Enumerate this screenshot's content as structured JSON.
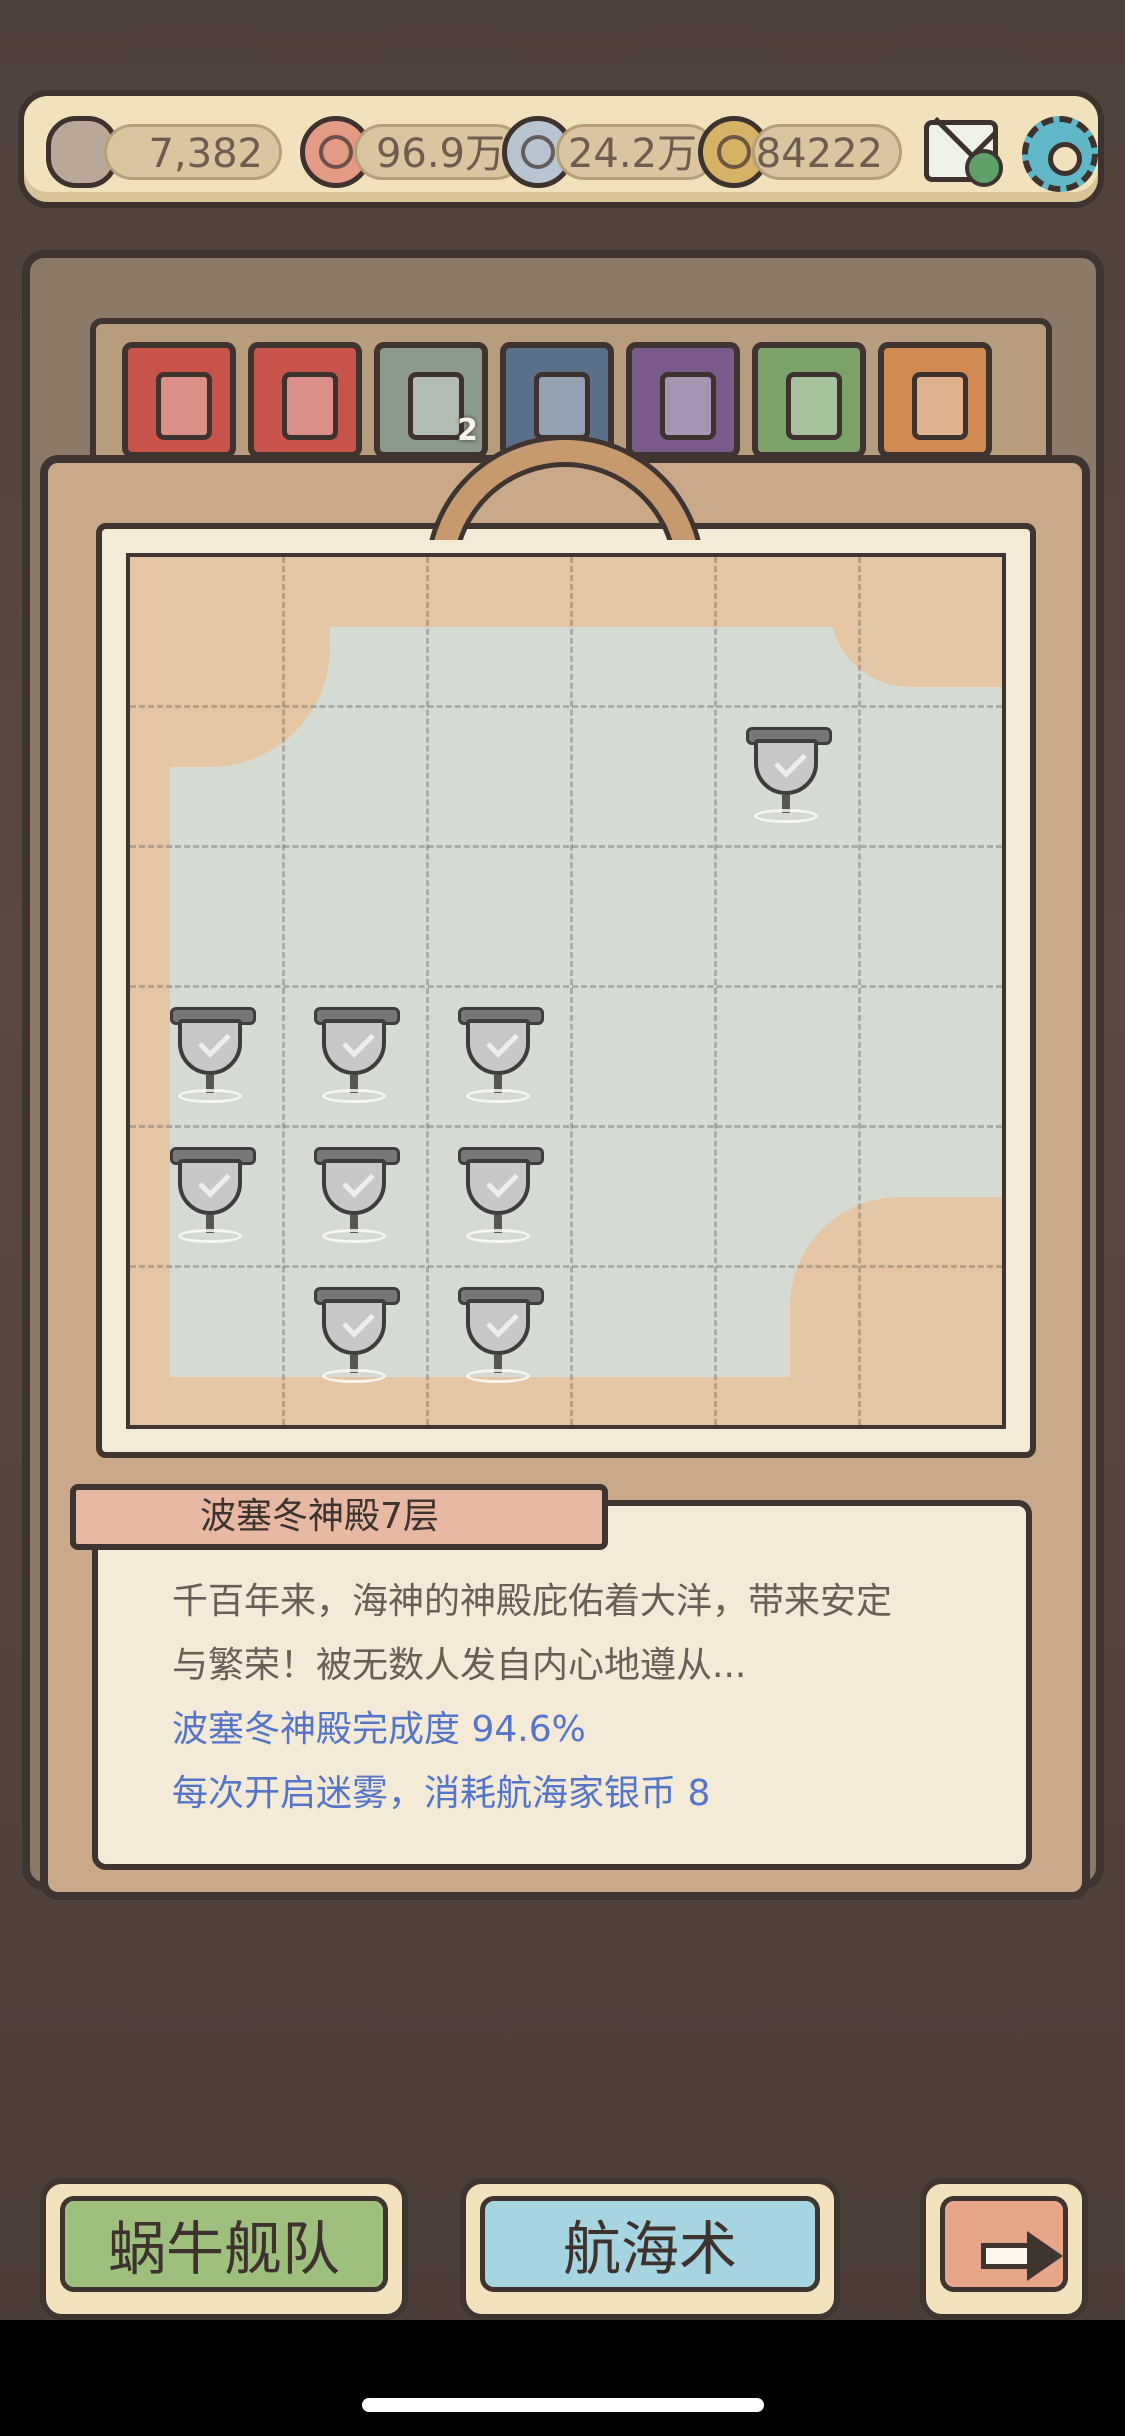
{
  "resources": {
    "snail_count": "7,382",
    "currency_red": "96.9万",
    "currency_silver": "24.2万",
    "currency_gold": "84222"
  },
  "items": [
    {
      "icon": "battery-red-icon",
      "color": "#c7534b"
    },
    {
      "icon": "battery-red-icon",
      "color": "#c7534b"
    },
    {
      "icon": "hourglass-icon",
      "color": "#8b9a8a",
      "badge": "2"
    },
    {
      "icon": "ship-wheel-icon",
      "color": "#5a6f8a"
    },
    {
      "icon": "cannon-icon",
      "color": "#7a5b8b"
    },
    {
      "icon": "potion-icon",
      "color": "#7ca26a"
    },
    {
      "icon": "ticket-icon",
      "color": "#d08a52"
    }
  ],
  "location": {
    "title": "波塞冬神殿7层",
    "description_line1": "千百年来，海神的神殿庇佑着大洋，带来安定",
    "description_line2": "与繁荣！被无数人发自内心地遵从...",
    "completion": "波塞冬神殿完成度 94.6%",
    "cost": "每次开启迷雾，消耗航海家银币 8"
  },
  "buttons": {
    "fleet": "蜗牛舰队",
    "navigation": "航海术"
  },
  "colors": {
    "fleet_button": "#9ebf7e",
    "navigation_button": "#a6d4e0",
    "next_button": "#e7a689",
    "accent_blue": "#5675c8"
  }
}
